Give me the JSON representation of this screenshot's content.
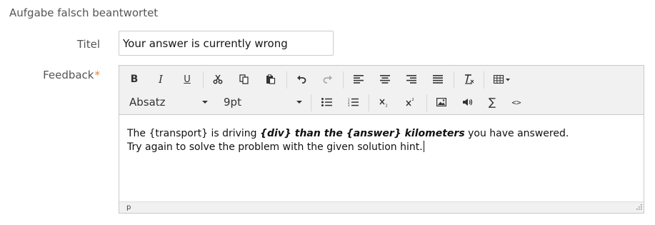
{
  "section": {
    "title": "Aufgabe falsch beantwortet"
  },
  "fields": {
    "title_label": "Titel",
    "title_value": "Your answer is currently wrong",
    "feedback_label": "Feedback",
    "required_mark": "*"
  },
  "toolbar": {
    "format_select": "Absatz",
    "size_select": "9pt",
    "bold": "B",
    "italic": "I",
    "underline": "U",
    "sum": "∑",
    "code": "<>"
  },
  "content": {
    "line1_a": "The {transport} is driving ",
    "line1_b": "{div} than the {answer} kilometers",
    "line1_c": " you have answered.",
    "line2": "Try again to solve the problem with the given solution hint."
  },
  "statusbar": {
    "path": "p"
  },
  "colors": {
    "required": "#e8822d",
    "label": "#555555",
    "toolbar_bg": "#f1f1f1"
  }
}
